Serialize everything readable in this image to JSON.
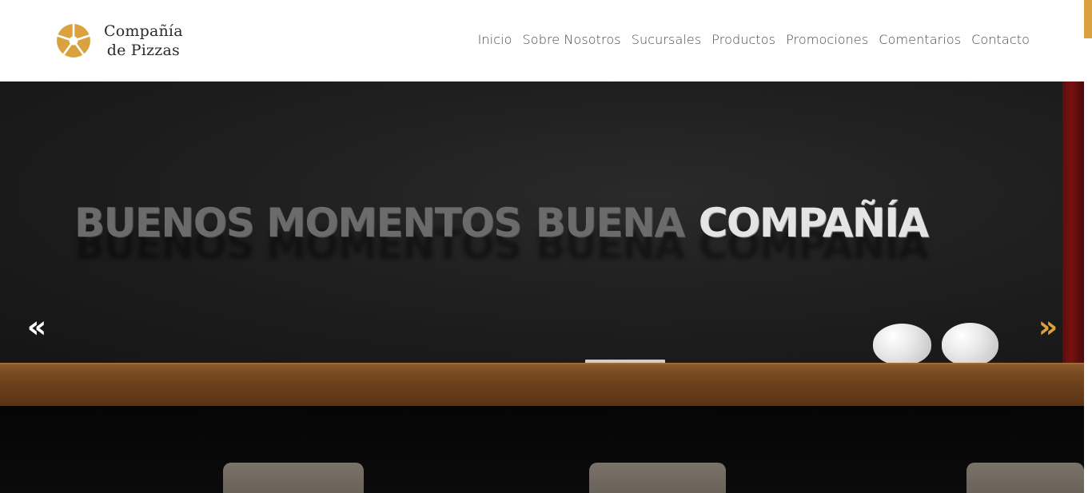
{
  "brand": {
    "name_line1": "Compañía",
    "name_line2": "de Pizzas",
    "icon": "pizza-slices-icon",
    "accent_color": "#d9a23f"
  },
  "nav": {
    "items": [
      {
        "label": "Inicio"
      },
      {
        "label": "Sobre Nosotros"
      },
      {
        "label": "Sucursales"
      },
      {
        "label": "Productos"
      },
      {
        "label": "Promociones"
      },
      {
        "label": "Comentarios"
      },
      {
        "label": "Contacto"
      }
    ]
  },
  "hero": {
    "headline_part1": "BUENOS MOMENTOS",
    "headline_part2": "BUENA",
    "headline_part3": "COMPAÑÍA",
    "prev_icon": "double-chevron-left-icon",
    "next_icon": "double-chevron-right-icon",
    "prev_glyph": "«",
    "next_glyph": "»"
  }
}
